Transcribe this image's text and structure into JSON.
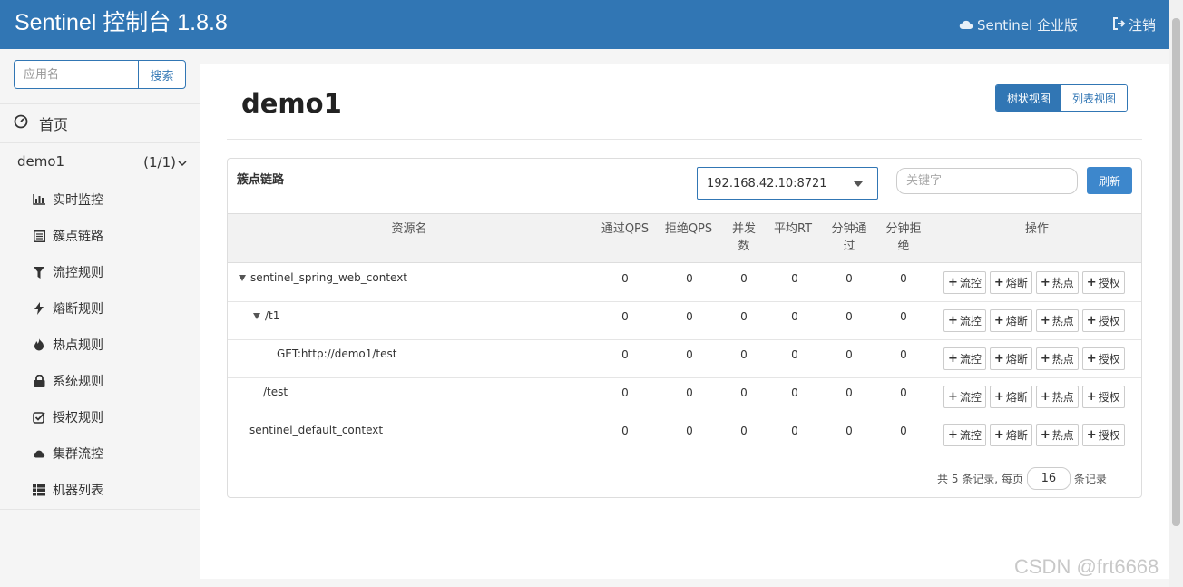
{
  "header": {
    "brand": "Sentinel 控制台 1.8.8",
    "enterprise_label": "Sentinel 企业版",
    "logout_label": "注销"
  },
  "sidebar": {
    "search_placeholder": "应用名",
    "search_button": "搜索",
    "home_label": "首页",
    "app_name": "demo1",
    "app_count": "(1/1)",
    "items": [
      {
        "label": "实时监控",
        "icon": "bar-chart-icon"
      },
      {
        "label": "簇点链路",
        "icon": "list-icon"
      },
      {
        "label": "流控规则",
        "icon": "filter-icon"
      },
      {
        "label": "熔断规则",
        "icon": "flash-icon"
      },
      {
        "label": "热点规则",
        "icon": "fire-icon"
      },
      {
        "label": "系统规则",
        "icon": "lock-icon"
      },
      {
        "label": "授权规则",
        "icon": "check-icon"
      },
      {
        "label": "集群流控",
        "icon": "cloud-icon"
      },
      {
        "label": "机器列表",
        "icon": "th-list-icon"
      }
    ]
  },
  "main": {
    "title": "demo1",
    "view_tree": "树状视图",
    "view_list": "列表视图",
    "panel_label": "簇点链路",
    "machine": "192.168.42.10:8721",
    "keyword_placeholder": "关键字",
    "refresh": "刷新",
    "columns": {
      "resource": "资源名",
      "pass_qps": "通过QPS",
      "block_qps": "拒绝QPS",
      "concurrency_1": "并发",
      "concurrency_2": "数",
      "avg_rt": "平均RT",
      "minute_pass_1": "分钟通",
      "minute_pass_2": "过",
      "minute_block_1": "分钟拒",
      "minute_block_2": "绝",
      "ops": "操作"
    },
    "rows": [
      {
        "name": "sentinel_spring_web_context",
        "values": [
          "0",
          "0",
          "0",
          "0",
          "0",
          "0"
        ]
      },
      {
        "name": "/t1",
        "values": [
          "0",
          "0",
          "0",
          "0",
          "0",
          "0"
        ]
      },
      {
        "name": "GET:http://demo1/test",
        "values": [
          "0",
          "0",
          "0",
          "0",
          "0",
          "0"
        ]
      },
      {
        "name": "/test",
        "values": [
          "0",
          "0",
          "0",
          "0",
          "0",
          "0"
        ]
      },
      {
        "name": "sentinel_default_context",
        "values": [
          "0",
          "0",
          "0",
          "0",
          "0",
          "0"
        ]
      }
    ],
    "op_labels": {
      "flow": "流控",
      "degrade": "熔断",
      "hot": "热点",
      "auth": "授权"
    },
    "pager": {
      "prefix": "共 5 条记录, 每页",
      "page_size": "16",
      "suffix": "条记录"
    }
  },
  "watermark": "CSDN @frt6668",
  "colors": {
    "primary": "#3176b4",
    "button": "#3d87cc"
  }
}
